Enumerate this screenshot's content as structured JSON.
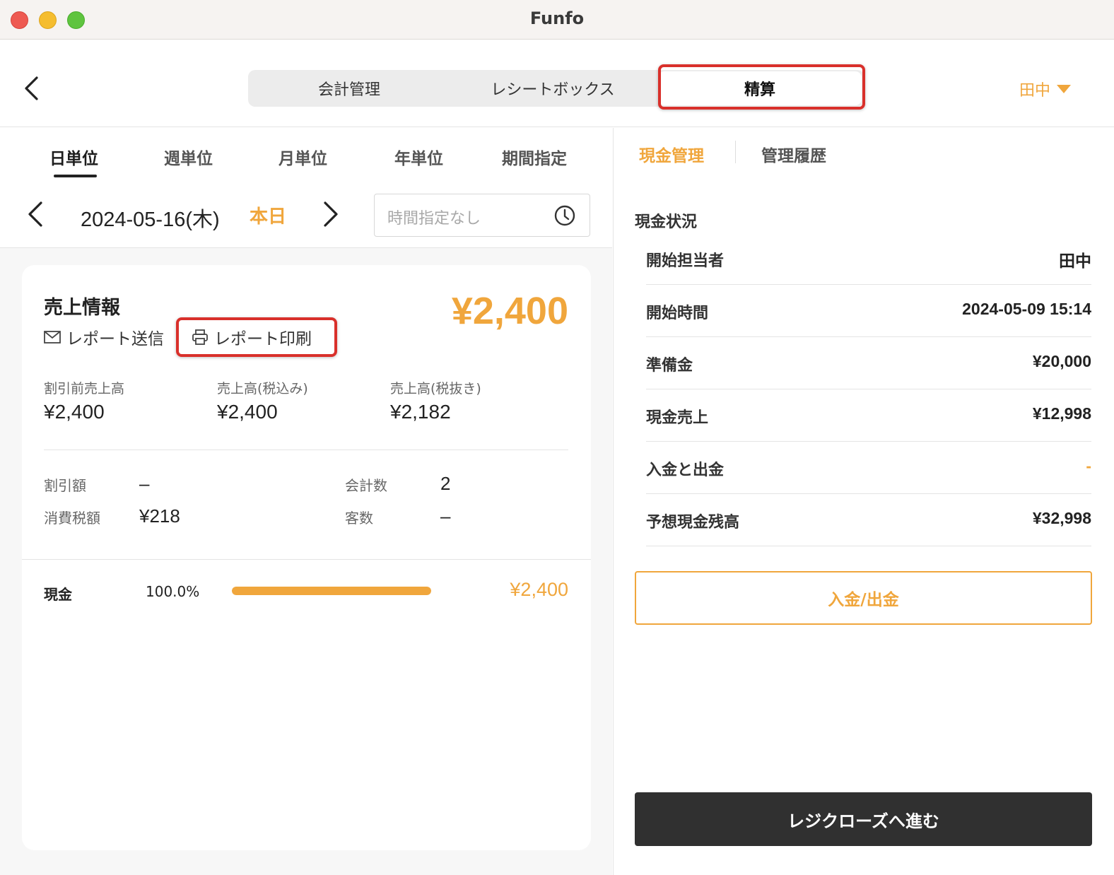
{
  "window": {
    "title": "Funfo"
  },
  "header": {
    "tabs": [
      {
        "label": "会計管理"
      },
      {
        "label": "レシートボックス"
      },
      {
        "label": "精算"
      }
    ],
    "user": "田中"
  },
  "period_tabs": [
    "日単位",
    "週単位",
    "月単位",
    "年単位",
    "期間指定"
  ],
  "date_nav": {
    "date": "2024-05-16(木)",
    "today_label": "本日",
    "time_placeholder": "時間指定なし"
  },
  "sales": {
    "title": "売上情報",
    "total": "¥2,400",
    "send_label": "レポート送信",
    "print_label": "レポート印刷",
    "metrics": [
      {
        "label": "割引前売上高",
        "value": "¥2,400"
      },
      {
        "label": "売上高(税込み)",
        "value": "¥2,400"
      },
      {
        "label": "売上高(税抜き)",
        "value": "¥2,182"
      }
    ],
    "details": {
      "discount_label": "割引額",
      "discount_value": "–",
      "tax_label": "消費税額",
      "tax_value": "¥218",
      "count_label": "会計数",
      "count_value": "2",
      "customers_label": "客数",
      "customers_value": "–"
    },
    "payment": {
      "label": "現金",
      "percent_text": "100.0%",
      "percent": 100,
      "amount": "¥2,400"
    }
  },
  "cash": {
    "tabs": [
      "現金管理",
      "管理履歴"
    ],
    "section_title": "現金状況",
    "rows": [
      {
        "label": "開始担当者",
        "value": "田中"
      },
      {
        "label": "開始時間",
        "value": "2024-05-09 15:14"
      },
      {
        "label": "準備金",
        "value": "¥20,000"
      },
      {
        "label": "現金売上",
        "value": "¥12,998"
      },
      {
        "label": "入金と出金",
        "value": "-"
      },
      {
        "label": "予想現金残高",
        "value": "¥32,998"
      }
    ],
    "deposit_button": "入金/出金",
    "close_button": "レジクローズへ進む"
  },
  "colors": {
    "accent": "#f0a63c",
    "highlight": "#d9302b",
    "dark_button": "#303030"
  }
}
